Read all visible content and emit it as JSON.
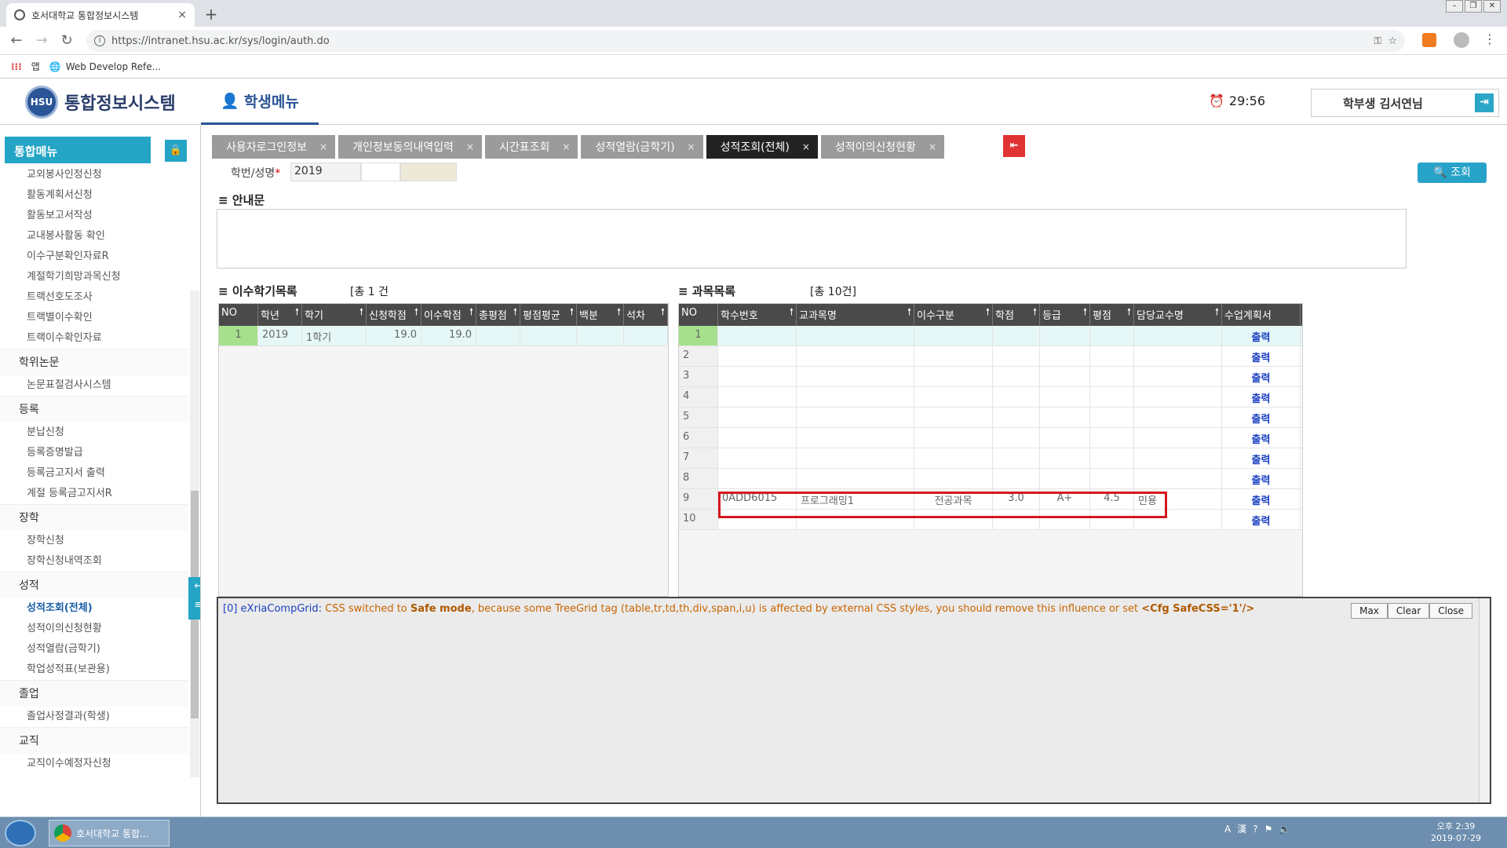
{
  "browser": {
    "tab_title": "호서대학교 통합정보시스템",
    "url": "https://intranet.hsu.ac.kr/sys/login/auth.do",
    "bookmarks": [
      "앱",
      "Web Develop Refe..."
    ]
  },
  "app": {
    "logo_text": "통합정보시스템",
    "student_menu": "학생메뉴",
    "timer": "29:56",
    "user": "학부생 김서연님"
  },
  "sidebar": {
    "title": "통합메뉴",
    "items": [
      {
        "type": "item",
        "label": "교외봉사인정신청"
      },
      {
        "type": "item",
        "label": "활동계획서신청"
      },
      {
        "type": "item",
        "label": "활동보고서작성"
      },
      {
        "type": "item",
        "label": "교내봉사활동 확인"
      },
      {
        "type": "item",
        "label": "이수구분확인자료R"
      },
      {
        "type": "item",
        "label": "계절학기희망과목신청"
      },
      {
        "type": "item",
        "label": "트랙선호도조사"
      },
      {
        "type": "item",
        "label": "트랙별이수확인"
      },
      {
        "type": "item",
        "label": "트랙이수확인자료"
      },
      {
        "type": "section",
        "label": "학위논문"
      },
      {
        "type": "item",
        "label": "논문표절검사시스템"
      },
      {
        "type": "section",
        "label": "등록"
      },
      {
        "type": "item",
        "label": "분납신청"
      },
      {
        "type": "item",
        "label": "등록증명발급"
      },
      {
        "type": "item",
        "label": "등록금고지서 출력"
      },
      {
        "type": "item",
        "label": "계절 등록금고지서R"
      },
      {
        "type": "section",
        "label": "장학"
      },
      {
        "type": "item",
        "label": "장학신청"
      },
      {
        "type": "item",
        "label": "장학신청내역조회"
      },
      {
        "type": "section",
        "label": "성적"
      },
      {
        "type": "item",
        "label": "성적조회(전체)",
        "active": true
      },
      {
        "type": "item",
        "label": "성적이의신청현황"
      },
      {
        "type": "item",
        "label": "성적열람(금학기)"
      },
      {
        "type": "item",
        "label": "학업성적표(보관용)"
      },
      {
        "type": "section",
        "label": "졸업"
      },
      {
        "type": "item",
        "label": "졸업사정결과(학생)"
      },
      {
        "type": "section",
        "label": "교직"
      },
      {
        "type": "item",
        "label": "교직이수예정자신청"
      }
    ]
  },
  "tabs": [
    "사용자로그인정보",
    "개인정보동의내역입력",
    "시간표조회",
    "성적열람(금학기)",
    "성적조회(전체)",
    "성적이의신청현황"
  ],
  "active_tab": 4,
  "search": {
    "label": "학번/성명",
    "required_mark": "*",
    "student_id": "2019",
    "button": "조회"
  },
  "notice": {
    "title": "안내문"
  },
  "semester_grid": {
    "title": "이수학기목록",
    "count": "[총    1 건",
    "columns": [
      "NO",
      "학년",
      "학기",
      "신청학점",
      "이수학점",
      "총평점",
      "평점평균",
      "백분",
      "석차"
    ],
    "rows": [
      [
        "1",
        "2019",
        "1학기",
        "19.0",
        "19.0",
        "",
        "",
        "",
        ""
      ]
    ]
  },
  "course_grid": {
    "title": "과목목록",
    "count": "[총    10건]",
    "columns": [
      "NO",
      "학수번호",
      "교과목명",
      "이수구분",
      "학점",
      "등급",
      "평점",
      "담당교수명",
      "수업계획서"
    ],
    "rows": [
      [
        "1",
        "",
        "",
        "",
        "",
        "",
        "",
        "",
        "출력"
      ],
      [
        "2",
        "",
        "",
        "",
        "",
        "",
        "",
        "",
        "출력"
      ],
      [
        "3",
        "",
        "",
        "",
        "",
        "",
        "",
        "",
        "출력"
      ],
      [
        "4",
        "",
        "",
        "",
        "",
        "",
        "",
        "",
        "출력"
      ],
      [
        "5",
        "",
        "",
        "",
        "",
        "",
        "",
        "",
        "출력"
      ],
      [
        "6",
        "",
        "",
        "",
        "",
        "",
        "",
        "",
        "출력"
      ],
      [
        "7",
        "",
        "",
        "",
        "",
        "",
        "",
        "",
        "출력"
      ],
      [
        "8",
        "",
        "",
        "",
        "",
        "",
        "",
        "",
        "출력"
      ],
      [
        "9",
        "0ADD6015",
        "프로그래밍1",
        "전공과목",
        "3.0",
        "A+",
        "4.5",
        "민용",
        "출력"
      ],
      [
        "10",
        "",
        "",
        "",
        "",
        "",
        "",
        "",
        "출력"
      ]
    ]
  },
  "debug": {
    "prefix": "[0] eXriaCompGrid:",
    "msg1": " CSS switched to ",
    "bold1": "Safe mode",
    "msg2": ", because some TreeGrid tag (table,tr,td,th,div,span,i,u) is affected by external CSS styles, you should remove this influence or set ",
    "bold2": "<Cfg SafeCSS='1'/>",
    "buttons": [
      "Max",
      "Clear",
      "Close"
    ]
  },
  "taskbar": {
    "app": "호서대학교 통합...",
    "time": "오후 2:39",
    "date": "2019-07-29"
  }
}
